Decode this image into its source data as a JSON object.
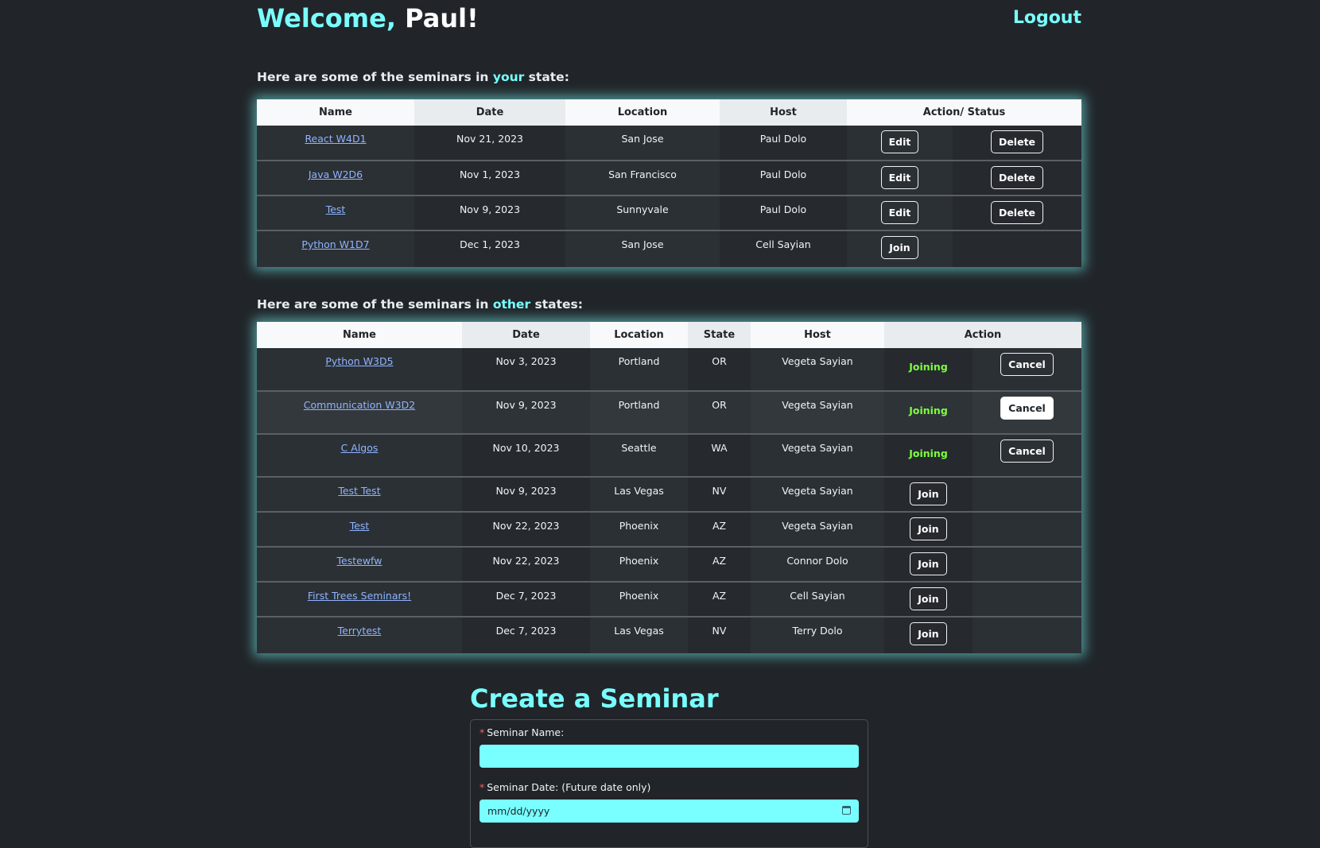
{
  "header": {
    "welcome_prefix": "Welcome, ",
    "user_name": "Paul!",
    "logout_label": "Logout"
  },
  "your_state": {
    "heading_pre": "Here are some of the seminars in ",
    "heading_hl": "your",
    "heading_post": " state:",
    "columns": [
      "Name",
      "Date",
      "Location",
      "Host",
      "Action/ Status"
    ],
    "rows": [
      {
        "name": "React W4D1",
        "date": "Nov 21, 2023",
        "location": "San Jose",
        "host": "Paul Dolo",
        "actions": [
          "Edit",
          "Delete"
        ]
      },
      {
        "name": "Java W2D6",
        "date": "Nov 1, 2023",
        "location": "San Francisco",
        "host": "Paul Dolo",
        "actions": [
          "Edit",
          "Delete"
        ]
      },
      {
        "name": "Test",
        "date": "Nov 9, 2023",
        "location": "Sunnyvale",
        "host": "Paul Dolo",
        "actions": [
          "Edit",
          "Delete"
        ]
      },
      {
        "name": "Python W1D7",
        "date": "Dec 1, 2023",
        "location": "San Jose",
        "host": "Cell Sayian",
        "actions": [
          "Join"
        ]
      }
    ]
  },
  "other_states": {
    "heading_pre": "Here are some of the seminars in ",
    "heading_hl": "other",
    "heading_post": " states:",
    "columns": [
      "Name",
      "Date",
      "Location",
      "State",
      "Host",
      "Action"
    ],
    "rows": [
      {
        "name": "Python W3D5",
        "date": "Nov 3, 2023",
        "location": "Portland",
        "state": "OR",
        "host": "Vegeta Sayian",
        "status": "Joining",
        "action": "Cancel"
      },
      {
        "name": "Communication W3D2",
        "date": "Nov 9, 2023",
        "location": "Portland",
        "state": "OR",
        "host": "Vegeta Sayian",
        "status": "Joining",
        "action": "Cancel",
        "hover": true
      },
      {
        "name": "C Algos",
        "date": "Nov 10, 2023",
        "location": "Seattle",
        "state": "WA",
        "host": "Vegeta Sayian",
        "status": "Joining",
        "action": "Cancel"
      },
      {
        "name": "Test Test",
        "date": "Nov 9, 2023",
        "location": "Las Vegas",
        "state": "NV",
        "host": "Vegeta Sayian",
        "status": "",
        "action": "Join"
      },
      {
        "name": "Test",
        "date": "Nov 22, 2023",
        "location": "Phoenix",
        "state": "AZ",
        "host": "Vegeta Sayian",
        "status": "",
        "action": "Join"
      },
      {
        "name": "Testewfw",
        "date": "Nov 22, 2023",
        "location": "Phoenix",
        "state": "AZ",
        "host": "Connor Dolo",
        "status": "",
        "action": "Join"
      },
      {
        "name": "First Trees Seminars!",
        "date": "Dec 7, 2023",
        "location": "Phoenix",
        "state": "AZ",
        "host": "Cell Sayian",
        "status": "",
        "action": "Join"
      },
      {
        "name": "Terrytest",
        "date": "Dec 7, 2023",
        "location": "Las Vegas",
        "state": "NV",
        "host": "Terry Dolo",
        "status": "",
        "action": "Join"
      }
    ]
  },
  "create_form": {
    "title": "Create a Seminar",
    "required_mark": "*",
    "name_label": "Seminar Name:",
    "name_value": "",
    "date_label": "Seminar Date: (Future date only)",
    "date_placeholder": "mm/dd/yyyy"
  },
  "colors": {
    "accent": "#79ffff",
    "background": "#212529",
    "link": "#8fb4ff",
    "joining": "#7dff3c"
  },
  "icons": {
    "date_picker": "calendar-icon"
  }
}
